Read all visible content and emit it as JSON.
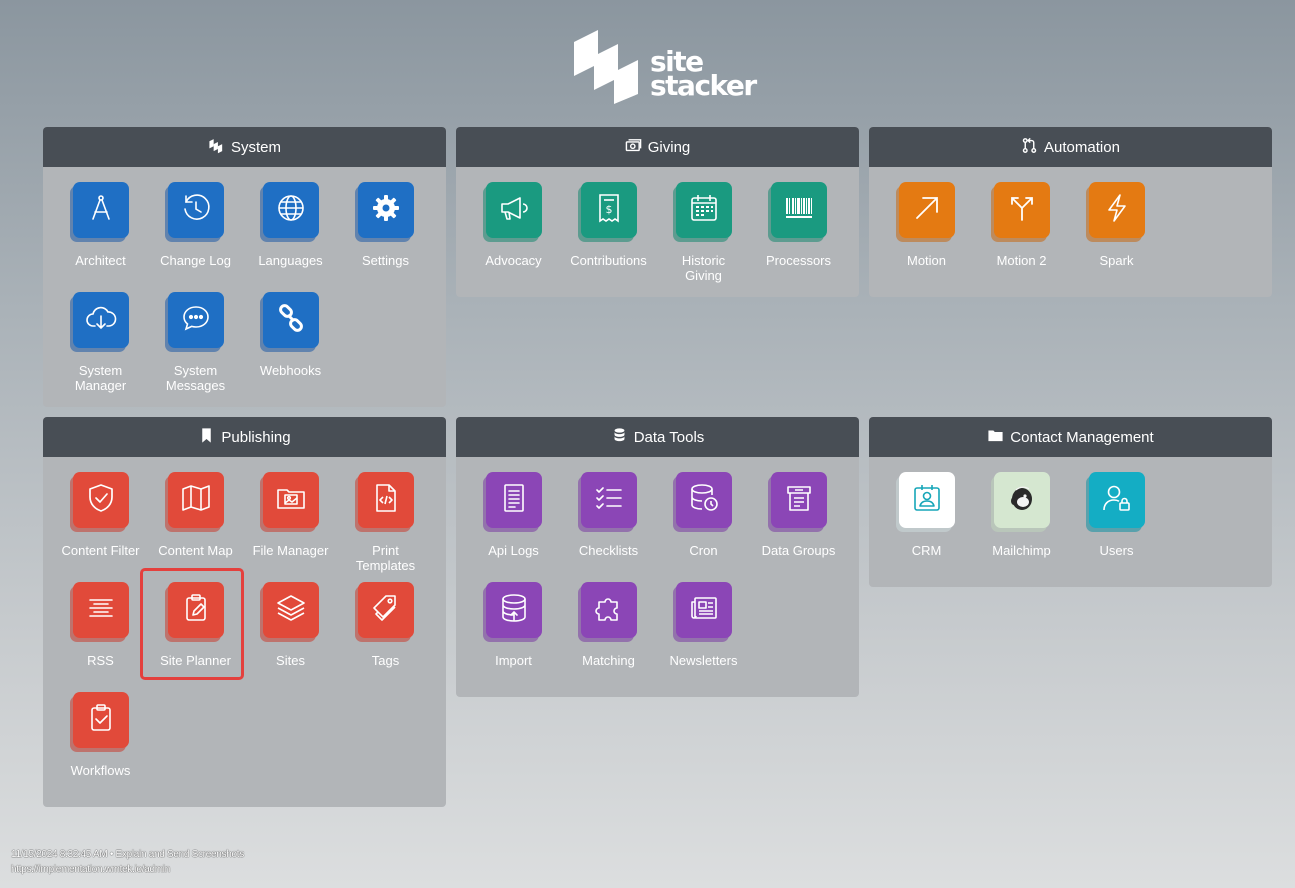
{
  "logo": {
    "line1": "site",
    "line2": "stacker"
  },
  "panels": {
    "system": {
      "title": "System",
      "tiles": [
        {
          "label": "Architect",
          "icon": "compass-icon"
        },
        {
          "label": "Change Log",
          "icon": "history-icon"
        },
        {
          "label": "Languages",
          "icon": "globe-icon"
        },
        {
          "label": "Settings",
          "icon": "gear-icon"
        },
        {
          "label": "System\nManager",
          "icon": "cloud-download-icon"
        },
        {
          "label": "System\nMessages",
          "icon": "chat-bubble-icon"
        },
        {
          "label": "Webhooks",
          "icon": "link-icon"
        }
      ]
    },
    "giving": {
      "title": "Giving",
      "tiles": [
        {
          "label": "Advocacy",
          "icon": "megaphone-icon"
        },
        {
          "label": "Contributions",
          "icon": "receipt-icon"
        },
        {
          "label": "Historic\nGiving",
          "icon": "calendar-icon"
        },
        {
          "label": "Processors",
          "icon": "barcode-icon"
        }
      ]
    },
    "automation": {
      "title": "Automation",
      "tiles": [
        {
          "label": "Motion",
          "icon": "arrow-up-right-icon"
        },
        {
          "label": "Motion 2",
          "icon": "split-arrow-icon"
        },
        {
          "label": "Spark",
          "icon": "lightning-icon"
        }
      ]
    },
    "publishing": {
      "title": "Publishing",
      "tiles": [
        {
          "label": "Content Filter",
          "icon": "shield-check-icon"
        },
        {
          "label": "Content Map",
          "icon": "map-icon"
        },
        {
          "label": "File Manager",
          "icon": "folder-image-icon"
        },
        {
          "label": "Print\nTemplates",
          "icon": "code-file-icon"
        },
        {
          "label": "RSS",
          "icon": "align-center-icon"
        },
        {
          "label": "Site Planner",
          "icon": "clipboard-edit-icon"
        },
        {
          "label": "Sites",
          "icon": "layers-icon"
        },
        {
          "label": "Tags",
          "icon": "tags-icon"
        },
        {
          "label": "Workflows",
          "icon": "clipboard-check-icon"
        }
      ]
    },
    "datatools": {
      "title": "Data Tools",
      "tiles": [
        {
          "label": "Api Logs",
          "icon": "document-icon"
        },
        {
          "label": "Checklists",
          "icon": "checklist-icon"
        },
        {
          "label": "Cron",
          "icon": "database-clock-icon"
        },
        {
          "label": "Data Groups",
          "icon": "file-list-icon"
        },
        {
          "label": "Import",
          "icon": "database-upload-icon"
        },
        {
          "label": "Matching",
          "icon": "puzzle-icon"
        },
        {
          "label": "Newsletters",
          "icon": "newspaper-icon"
        }
      ]
    },
    "contact": {
      "title": "Contact Management",
      "tiles": [
        {
          "label": "CRM",
          "icon": "contact-card-icon"
        },
        {
          "label": "Mailchimp",
          "icon": "mailchimp-icon"
        },
        {
          "label": "Users",
          "icon": "user-lock-icon"
        }
      ]
    }
  },
  "footer": {
    "line1": "11/15/2024 8:32:45 AM • Explain and Send Screenshots",
    "line2": "https://implementation.wmtek.io/admin"
  },
  "colors": {
    "system": "#1f6fc4",
    "giving": "#1a9a80",
    "automation": "#e47a12",
    "publishing": "#e14a3a",
    "datatools": "#8b46b6",
    "contact": "#14adc4",
    "header": "#484e55",
    "panel": "#b2b5b8",
    "highlight": "#e4403d"
  }
}
